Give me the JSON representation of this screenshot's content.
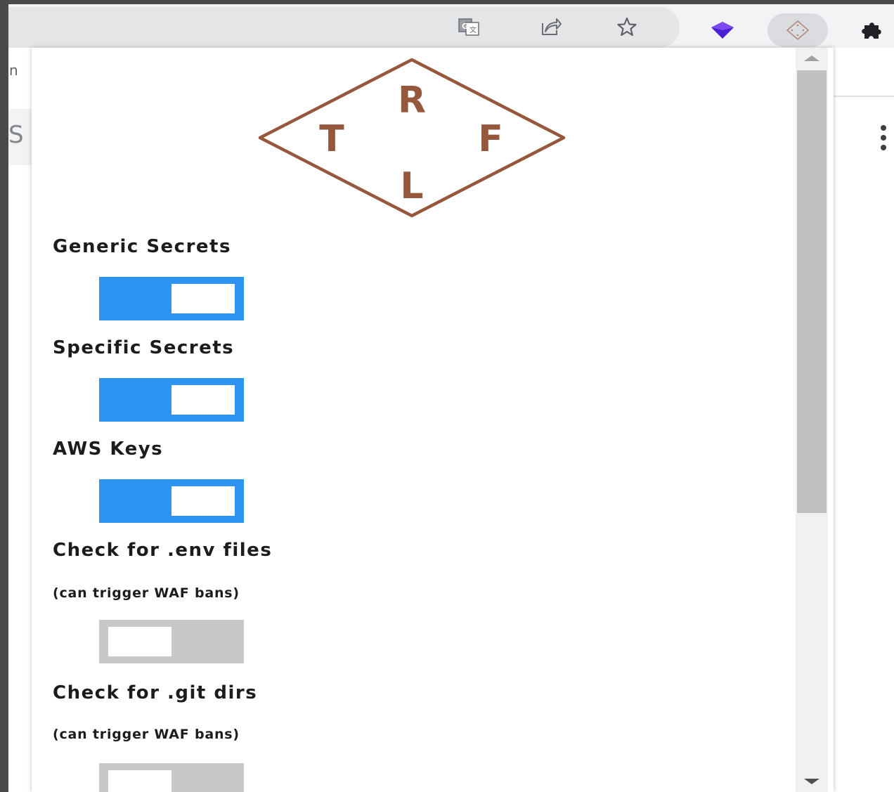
{
  "browser": {
    "toolbar_icons": [
      "translate-icon",
      "share-icon",
      "bookmark-star-icon"
    ],
    "extensions": [
      "purple-cube-extension-icon",
      "trufflehog-extension-icon",
      "puzzle-extensions-icon"
    ]
  },
  "background_page": {
    "fragment_n": "n",
    "fragment_s": "S"
  },
  "popup": {
    "logo": {
      "top": "R",
      "left": "T",
      "right": "F",
      "bottom": "L",
      "color": "#96583c"
    },
    "settings": [
      {
        "label": "Generic Secrets",
        "enabled": true
      },
      {
        "label": "Specific Secrets",
        "enabled": true
      },
      {
        "label": "AWS Keys",
        "enabled": true
      },
      {
        "label": "Check for .env files",
        "note": "(can trigger WAF bans)",
        "enabled": false
      },
      {
        "label": "Check for .git dirs",
        "note": "(can trigger WAF bans)",
        "enabled": false
      }
    ],
    "colors": {
      "toggle_on": "#2d95f1",
      "toggle_off": "#c8c8c8",
      "text": "#1c1c1c"
    }
  }
}
